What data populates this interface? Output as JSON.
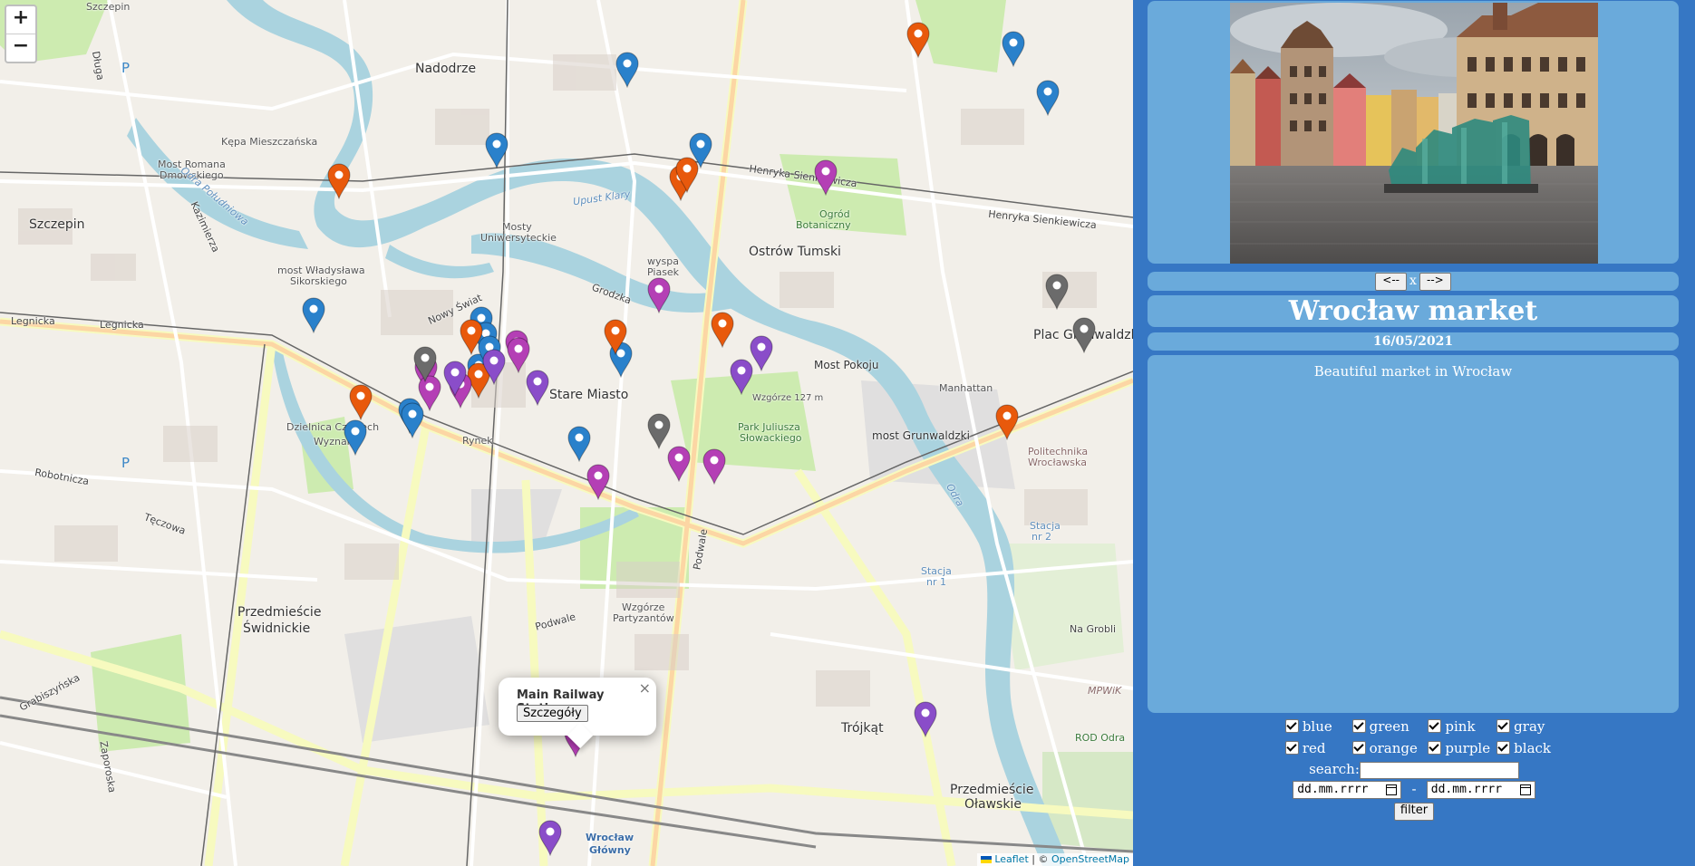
{
  "map": {
    "zoom_in_label": "+",
    "zoom_out_label": "−",
    "popup": {
      "title": "Main Railway Station",
      "button_label": "Szczegóły",
      "close_label": "×"
    },
    "attribution": {
      "leaflet": "Leaflet",
      "separator": " | © ",
      "osm": "OpenStreetMap"
    },
    "labels": {
      "szczepin_top": "Szczepin",
      "nadodrze": "Nadodrze",
      "kepa": "Kępa Mieszczańska",
      "most_romana": "Most Romana",
      "dmowskiego": "Dmowskiego",
      "szczepin": "Szczepin",
      "mosty_uniw": "Mosty",
      "uniwersyteckie": "Uniwersyteckie",
      "most_wl": "most Władysława",
      "sikorskiego": "Sikorskiego",
      "wyspa": "wyspa",
      "piasek": "Piasek",
      "ostrow": "Ostrów Tumski",
      "ogrod": "Ogród",
      "botaniczny": "Botaniczny",
      "stare_miasto": "Stare Miasto",
      "legnicka": "Legnicka",
      "legnicka2": "Legnicka",
      "nowy_swiat": "Nowy Świat",
      "dzielnica": "Dzielnica Czterech",
      "wyznan": "Wyznań",
      "rynek": "Rynek",
      "most_pokoju": "Most Pokoju",
      "plac_grunw": "Plac Grunwaldzki",
      "manhattan": "Manhattan",
      "most_grunw": "most Grunwaldzki",
      "politechnika": "Politechnika",
      "wroclawska": "Wrocławska",
      "park": "Park Juliusza",
      "slowackiego": "Słowackiego",
      "przedm_sw": "Przedmieście",
      "swidnickie": "Świdnickie",
      "wzgorze": "Wzgórze",
      "partyzantow": "Partyzantów",
      "trojkat": "Trójkąt",
      "przedm_ol": "Przedmieście",
      "olawskie": "Oławskie",
      "wroclaw_gl": "Wrocław",
      "glowny": "Główny",
      "podwale": "Podwale",
      "odra": "Odra",
      "odra_pol": "Odra Południowa",
      "upust": "Upust Klary",
      "na_grobli": "Na Grobli",
      "stacja1": "Stacja",
      "nr1": "nr 1",
      "stacja2": "Stacja",
      "nr2": "nr 2",
      "mpwik": "MPWiK",
      "rod": "ROD Odra",
      "dluga": "Długa",
      "grabiszynska": "Grabiszyńska",
      "zaporoska": "Zaporoska",
      "robotnicza": "Robotnicza",
      "henryka_sienk": "Henryka Sienkiewicza",
      "henryka_sienk2": "Henryka Sienkiewicza",
      "grodzka": "Grodzka",
      "kazimierza": "Kazimierza",
      "teczowa": "Tęczowa",
      "podwale2": "Podwale",
      "dolna": "Wzgórze 127 m"
    },
    "markers": [
      {
        "color": "#2a81cb"
      },
      {
        "color": "#2a81cb"
      },
      {
        "color": "#2a81cb"
      },
      {
        "color": "#2a81cb"
      },
      {
        "color": "#2a81cb"
      },
      {
        "color": "#2a81cb"
      },
      {
        "color": "#2a81cb"
      },
      {
        "color": "#2a81cb"
      },
      {
        "color": "#2a81cb"
      },
      {
        "color": "#2a81cb"
      },
      {
        "color": "#2a81cb"
      },
      {
        "color": "#2a81cb"
      },
      {
        "color": "#2a81cb"
      },
      {
        "color": "#2a81cb"
      },
      {
        "color": "#2a81cb"
      },
      {
        "color": "#e8590c"
      },
      {
        "color": "#e8590c"
      },
      {
        "color": "#e8590c"
      },
      {
        "color": "#e8590c"
      },
      {
        "color": "#e8590c"
      },
      {
        "color": "#e8590c"
      },
      {
        "color": "#e8590c"
      },
      {
        "color": "#e8590c"
      },
      {
        "color": "#e8590c"
      },
      {
        "color": "#e8590c"
      },
      {
        "color": "#b43fb5"
      },
      {
        "color": "#b43fb5"
      },
      {
        "color": "#b43fb5"
      },
      {
        "color": "#b43fb5"
      },
      {
        "color": "#b43fb5"
      },
      {
        "color": "#b43fb5"
      },
      {
        "color": "#b43fb5"
      },
      {
        "color": "#b43fb5"
      },
      {
        "color": "#b43fb5"
      },
      {
        "color": "#b43fb5"
      },
      {
        "color": "#b43fb5"
      },
      {
        "color": "#8a4dc9"
      },
      {
        "color": "#8a4dc9"
      },
      {
        "color": "#8a4dc9"
      },
      {
        "color": "#8a4dc9"
      },
      {
        "color": "#8a4dc9"
      },
      {
        "color": "#8a4dc9"
      },
      {
        "color": "#8a4dc9"
      },
      {
        "color": "#6b6b6b"
      },
      {
        "color": "#6b6b6b"
      },
      {
        "color": "#6b6b6b"
      },
      {
        "color": "#6b6b6b"
      }
    ]
  },
  "detail": {
    "prev_label": "<--",
    "close_label": "x",
    "next_label": "-->",
    "title": "Wrocław market",
    "date": "16/05/2021",
    "description": "Beautiful market in Wrocław"
  },
  "filters": {
    "blue": "blue",
    "green": "green",
    "pink": "pink",
    "gray": "gray",
    "red": "red",
    "orange": "orange",
    "purple": "purple",
    "black": "black",
    "search_label": "search:",
    "date_from_placeholder": "dd.mm.rrrr",
    "date_separator": "-",
    "date_to_placeholder": "dd.mm.rrrr",
    "filter_label": "filter"
  }
}
